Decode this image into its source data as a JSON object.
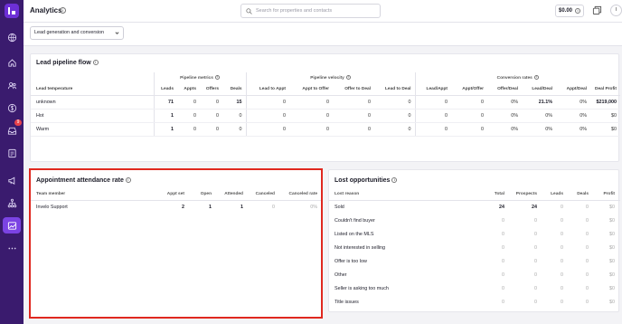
{
  "app": {
    "title": "Analytics",
    "balance": "$0.00",
    "avatar_initial": "I"
  },
  "search": {
    "placeholder": "Search for properties and contacts"
  },
  "filter": {
    "selected": "Lead generation and conversion"
  },
  "sidebar": {
    "icons": [
      "logo-icon",
      "globe-icon",
      "home-icon",
      "contacts-icon",
      "dollar-icon",
      "inbox-icon",
      "document-icon",
      "megaphone-icon",
      "org-chart-icon",
      "analytics-icon",
      "more-icon"
    ],
    "inbox_badge": "9"
  },
  "pipeline": {
    "title": "Lead pipeline flow",
    "groups": [
      "Pipeline metrics",
      "Pipeline velocity",
      "Conversion rates"
    ],
    "columns": [
      "Lead temperature",
      "Leads",
      "Appts",
      "Offers",
      "Deals",
      "Lead to Appt",
      "Appt to Offer",
      "Offer to Deal",
      "Lead to Deal",
      "Lead/Appt",
      "Appt/Offer",
      "Offer/Deal",
      "Lead/Deal",
      "Appt/Deal",
      "Deal Profit"
    ],
    "rows": [
      [
        "unknown",
        "71",
        "0",
        "0",
        "15",
        "0",
        "0",
        "0",
        "0",
        "0",
        "0",
        "0%",
        "21.1%",
        "0%",
        "$219,000"
      ],
      [
        "Hot",
        "1",
        "0",
        "0",
        "0",
        "0",
        "0",
        "0",
        "0",
        "0",
        "0",
        "0%",
        "0%",
        "0%",
        "$0"
      ],
      [
        "Warm",
        "1",
        "0",
        "0",
        "0",
        "0",
        "0",
        "0",
        "0",
        "0",
        "0",
        "0%",
        "0%",
        "0%",
        "$0"
      ]
    ]
  },
  "appointments": {
    "title": "Appointment attendance rate",
    "columns": [
      "Team member",
      "Appt set",
      "Open",
      "Attended",
      "Canceled",
      "Canceled rate"
    ],
    "rows": [
      [
        "Invelo Support",
        "2",
        "1",
        "1",
        "0",
        "0%"
      ]
    ]
  },
  "lost": {
    "title": "Lost opportunities",
    "columns": [
      "Lost reason",
      "Total",
      "Prospects",
      "Leads",
      "Deals",
      "Profit"
    ],
    "rows": [
      [
        "Sold",
        "24",
        "24",
        "0",
        "0",
        "$0"
      ],
      [
        "Couldn't find buyer",
        "0",
        "0",
        "0",
        "0",
        "$0"
      ],
      [
        "Listed on the MLS",
        "0",
        "0",
        "0",
        "0",
        "$0"
      ],
      [
        "Not interested in selling",
        "0",
        "0",
        "0",
        "0",
        "$0"
      ],
      [
        "Offer is too low",
        "0",
        "0",
        "0",
        "0",
        "$0"
      ],
      [
        "Other",
        "0",
        "0",
        "0",
        "0",
        "$0"
      ],
      [
        "Seller is asking too much",
        "0",
        "0",
        "0",
        "0",
        "$0"
      ],
      [
        "Title issues",
        "0",
        "0",
        "0",
        "0",
        "$0"
      ]
    ]
  }
}
